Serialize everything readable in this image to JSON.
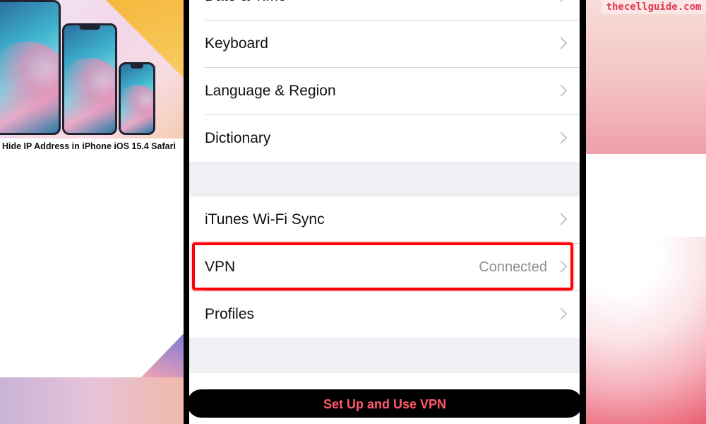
{
  "thumbnail": {
    "caption": "Hide IP Address in iPhone iOS 15.4 Safari"
  },
  "brand": {
    "site": "thecellguide.com"
  },
  "settings": {
    "group1": [
      {
        "label": "Date & Time"
      },
      {
        "label": "Keyboard"
      },
      {
        "label": "Language & Region"
      },
      {
        "label": "Dictionary"
      }
    ],
    "group2": [
      {
        "label": "iTunes Wi-Fi Sync",
        "value": ""
      },
      {
        "label": "VPN",
        "value": "Connected"
      },
      {
        "label": "Profiles",
        "value": ""
      }
    ]
  },
  "banner": {
    "text": "Set Up and Use VPN"
  },
  "colors": {
    "highlight": "#ff0008",
    "banner_text": "#ff5a6b",
    "brand_text": "#e23a53",
    "secondary_text": "#8e8e93",
    "grouped_background": "#efeff4"
  },
  "icons": [
    "chevron-right-icon",
    "phone-image"
  ]
}
